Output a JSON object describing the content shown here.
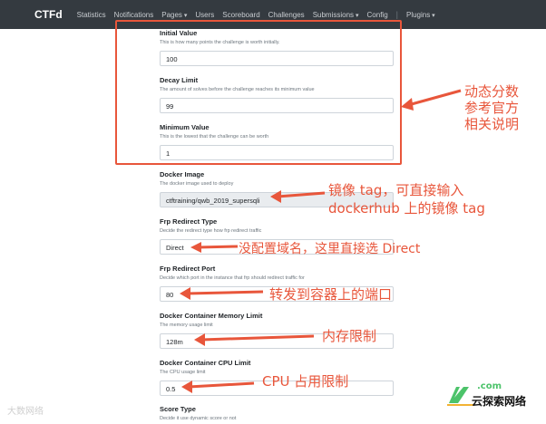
{
  "navbar": {
    "brand": "CTFd",
    "items": [
      "Statistics",
      "Notifications",
      "Pages",
      "Users",
      "Scoreboard",
      "Challenges",
      "Submissions",
      "Config",
      "Plugins"
    ],
    "separator": "|"
  },
  "form": {
    "initial_value": {
      "label": "Initial Value",
      "help": "This is how many points the challenge is worth initially.",
      "value": "100"
    },
    "decay_limit": {
      "label": "Decay Limit",
      "help": "The amount of solves before the challenge reaches its minimum value",
      "value": "99"
    },
    "minimum_value": {
      "label": "Minimum Value",
      "help": "This is the lowest that the challenge can be worth",
      "value": "1"
    },
    "docker_image": {
      "label": "Docker Image",
      "help": "The docker image used to deploy",
      "value": "ctftraining/qwb_2019_supersqli"
    },
    "frp_redirect_type": {
      "label": "Frp Redirect Type",
      "help": "Decide the redirect type how frp redirect traffic",
      "value": "Direct"
    },
    "frp_redirect_port": {
      "label": "Frp Redirect Port",
      "help": "Decide which port in the instance that frp should redirect traffic for",
      "value": "80"
    },
    "memory_limit": {
      "label": "Docker Container Memory Limit",
      "help": "The memory usage limit",
      "value": "128m"
    },
    "cpu_limit": {
      "label": "Docker Container CPU Limit",
      "help": "The CPU usage limit",
      "value": "0.5"
    },
    "score_type": {
      "label": "Score Type",
      "help": "Decide it use dynamic score or not"
    }
  },
  "annotations": {
    "dynamic_score": [
      "动态分数",
      "参考官方",
      "相关说明"
    ],
    "docker_image": [
      "镜像 tag，可直接输入",
      "dockerhub 上的镜像 tag"
    ],
    "redirect_type": "没配置域名，这里直接选 Direct",
    "redirect_port": "转发到容器上的端口",
    "memory": "内存限制",
    "cpu": "CPU 占用限制"
  },
  "watermarks": {
    "left": "大数网络",
    "right_url": ".com",
    "right": "云探索网络"
  },
  "colors": {
    "annotation": "#e8563b",
    "navbar": "#343a40"
  }
}
